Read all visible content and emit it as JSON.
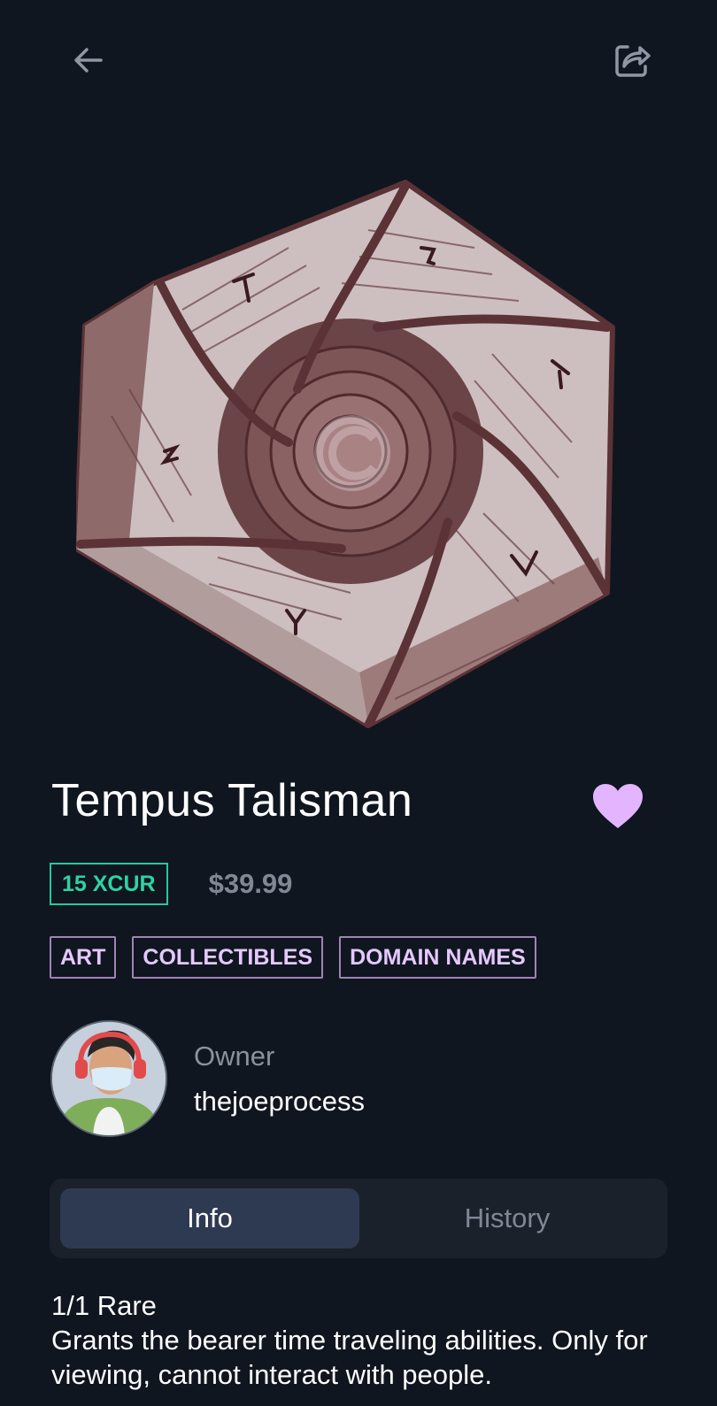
{
  "nav": {
    "back_icon": "arrow-left-icon",
    "share_icon": "share-icon"
  },
  "item": {
    "title": "Tempus Talisman",
    "crypto_price": "15 XCUR",
    "fiat_price": "$39.99",
    "favorite_icon": "heart-icon",
    "favorited": true,
    "tags": [
      "ART",
      "COLLECTIBLES",
      "DOMAIN NAMES"
    ]
  },
  "owner": {
    "label": "Owner",
    "username": "thejoeprocess"
  },
  "tabs": {
    "info": "Info",
    "history": "History",
    "active": "Info"
  },
  "details": {
    "rarity": "1/1 Rare",
    "description": "Grants the bearer time traveling abilities. Only for viewing, cannot interact with people."
  },
  "colors": {
    "background": "#0f161f",
    "crypto_accent": "#2ed3a3",
    "tag_text": "#e6c8ff",
    "heart": "#e3b5ff",
    "active_tab": "#2e3a52"
  }
}
